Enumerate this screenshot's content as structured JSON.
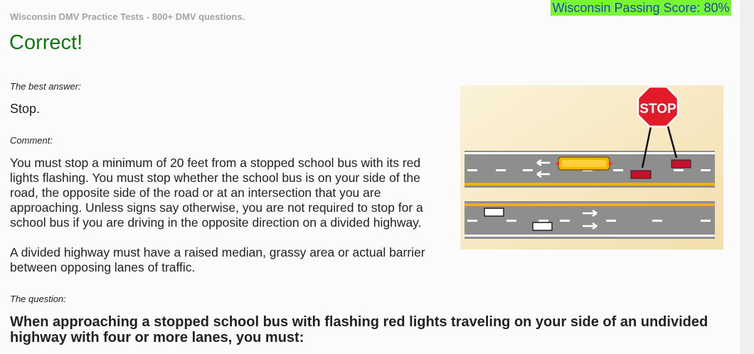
{
  "header": {
    "site_title": "Wisconsin DMV Practice Tests - 800+ DMV questions.",
    "passing_score": "Wisconsin Passing Score: 80%"
  },
  "result": {
    "title": "Correct!",
    "best_answer_label": "The best answer:",
    "best_answer": "Stop.",
    "comment_label": "Comment:",
    "comment_paragraph_1": "You must stop a minimum of 20 feet from a stopped school bus with its red lights flashing. You must stop whether the school bus is on your side of the road, the opposite side of the road or at an intersection that you are approaching. Unless signs say otherwise, you are not required to stop for a school bus if you are driving in the opposite direction on a divided highway.",
    "comment_paragraph_2": "A divided highway must have a raised median, grassy area or actual barrier between opposing lanes of traffic.",
    "question_label": "The question:",
    "question": "When approaching a stopped school bus with flashing red lights traveling on your side of an undivided highway with four or more lanes, you must:"
  },
  "illustration": {
    "stop_sign_text": "STOP"
  },
  "colors": {
    "correct": "#117711",
    "passing_bg": "#77f733",
    "passing_text": "#2244bb"
  }
}
